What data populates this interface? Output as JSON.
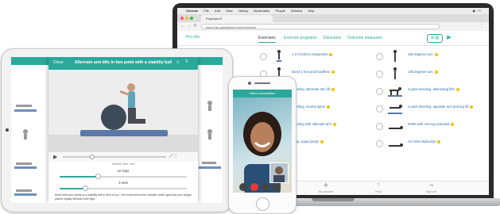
{
  "browser": {
    "menu": [
      "Chrome",
      "File",
      "Edit",
      "View",
      "History",
      "Bookmarks",
      "People",
      "Window",
      "Help"
    ],
    "tab_title": "Physiotec®",
    "url": "https://au.physiotec8.com/exercises"
  },
  "app_header": {
    "back_label": "‹ Pro info",
    "tabs": [
      "Exercises",
      "Exercise programs",
      "Education",
      "Outcome measures"
    ],
    "active_tab": "Exercises"
  },
  "exercises_right": [
    [
      "1-2-3 hold on trampoline",
      "180 degrees turn"
    ],
    [
      "stand 1 foot pool fourfliesi",
      "180 degrees turn"
    ],
    [
      "kneeling, alternate arm lift",
      "4 point kneeling, alternating lifts"
    ],
    [
      "kneeling, neutral spine",
      "4 point kneeling, opposite arm and leg lift"
    ],
    [
      "kneeling with alternate arm",
      "90/90 with one leg extended"
    ],
    [
      "jump, squat jumps",
      "A/A SMJ abduction"
    ]
  ],
  "bottom_nav": [
    "Exercises",
    "My account",
    "Help",
    "Sign out"
  ],
  "tablet": {
    "modal_close": "Close",
    "modal_title": "Alternate arm lifts in two point with a stability ball",
    "video_caption": "Stability Ball, Mat",
    "reps_label": "10 reps",
    "reps_fill": 0.3,
    "sets_label": "3 sets",
    "sets_fill": 0.2,
    "instructions": "Kneel with your hands on a stability ball in front of you. Your knees should be shoulder width apart and your weight placed equally between both legs."
  },
  "phone": {
    "call_title": "Video consultation"
  },
  "colors": {
    "accent": "#2ba89b",
    "link": "#2b6cb0",
    "badge": "#f2c200",
    "end_call": "#e53935"
  }
}
